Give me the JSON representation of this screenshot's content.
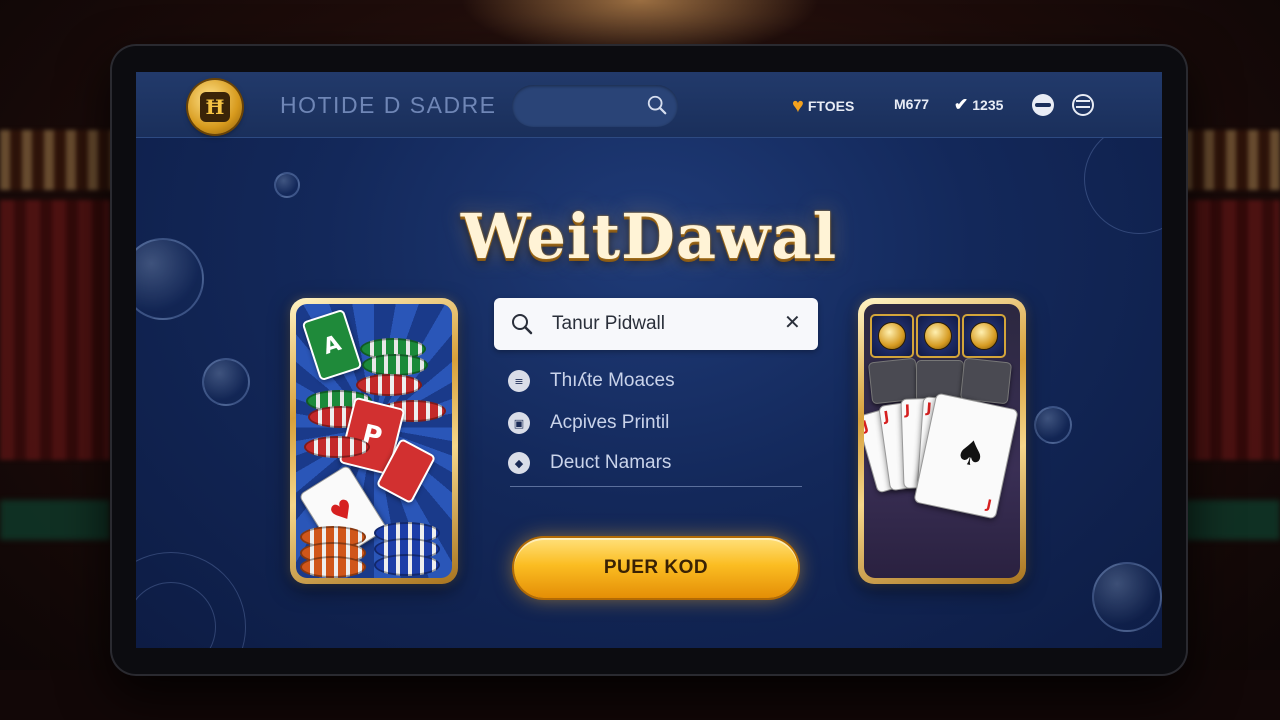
{
  "header": {
    "logo_glyph": "Ħ",
    "brand": "HOTIDE D SADRE",
    "search": {
      "value": "",
      "icon": "search-icon"
    },
    "stats": [
      {
        "icon": "heart-icon",
        "label": "FTOES"
      },
      {
        "icon": "",
        "label": "M677"
      },
      {
        "icon": "check-icon",
        "label": "1235"
      }
    ],
    "buttons": [
      {
        "icon": "globe-icon"
      },
      {
        "icon": "settings-icon"
      }
    ]
  },
  "main": {
    "title": "WeitDawal",
    "search": {
      "value": "Tanur Pidwall",
      "clear_icon": "close-icon"
    },
    "menu": [
      {
        "icon": "list-icon",
        "label": "Thıʎte Moaces"
      },
      {
        "icon": "lock-icon",
        "label": "Acpives Printil"
      },
      {
        "icon": "diamond-icon",
        "label": "Deuct Namars"
      }
    ],
    "cta_label": "PUER KOD"
  },
  "cards": {
    "left": {
      "theme": "chips-and-cards",
      "tcard1": "A",
      "tcard2": "P",
      "playcard_suit": "♥"
    },
    "right": {
      "theme": "slots-and-cards",
      "card_ranks": [
        "J",
        "J",
        "J",
        "J"
      ],
      "front_suit": "♠",
      "front_rank": "J"
    }
  },
  "colors": {
    "accent": "#fbbd22",
    "background": "#13285a",
    "title": "#fff3d6"
  }
}
